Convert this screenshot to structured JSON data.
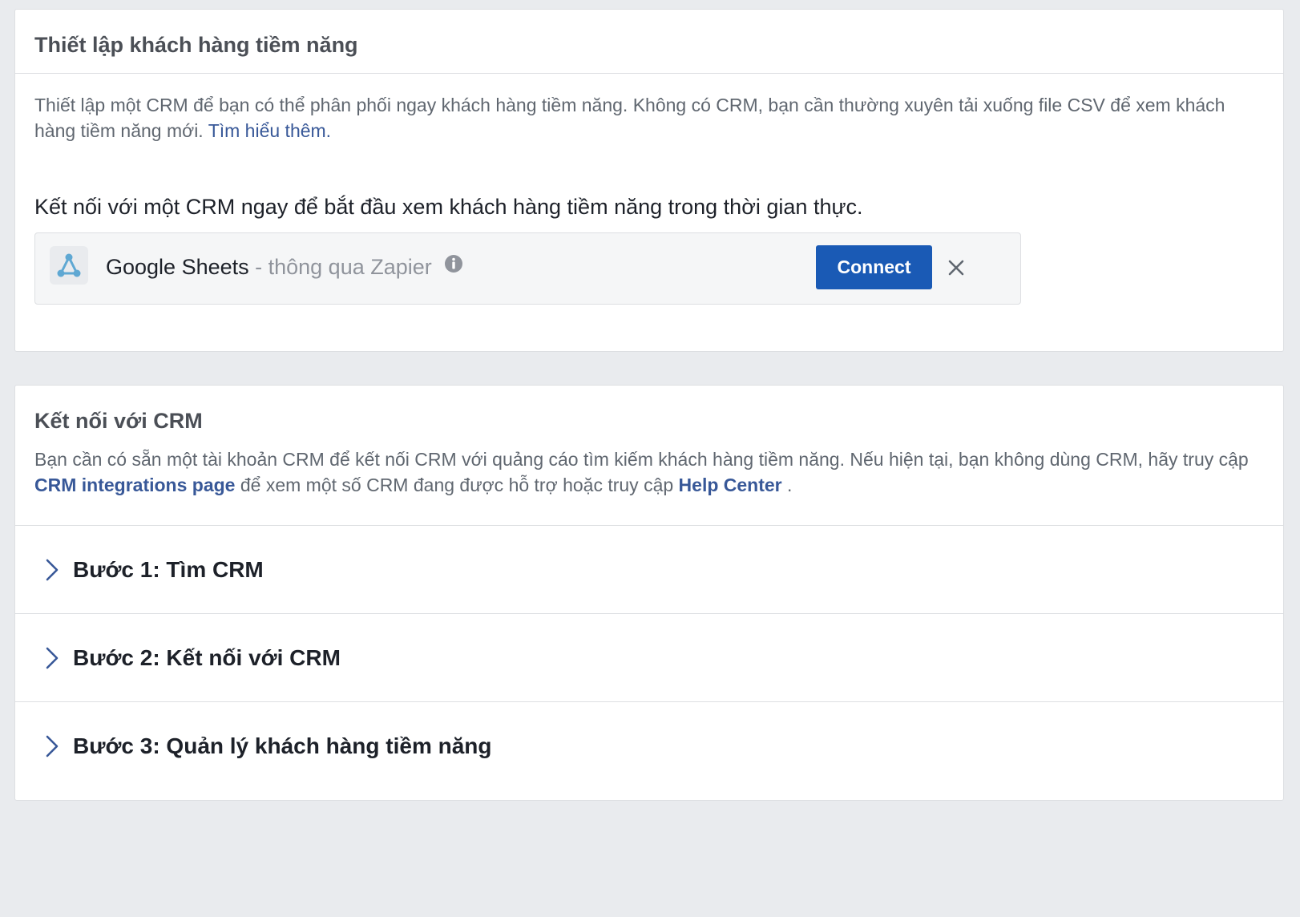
{
  "setup_card": {
    "title": "Thiết lập khách hàng tiềm năng",
    "description": "Thiết lập một CRM để bạn có thể phân phối ngay khách hàng tiềm năng. Không có CRM, bạn cần thường xuyên tải xuống file CSV để xem khách hàng tiềm năng mới.",
    "learn_more_link": "Tìm hiểu thêm.",
    "subheading": "Kết nối với một CRM ngay để bắt đầu xem khách hàng tiềm năng trong thời gian thực.",
    "crm": {
      "name": "Google Sheets",
      "via": " - thông qua Zapier",
      "logo_icon": "zapier-network-icon",
      "connect_label": "Connect"
    }
  },
  "connect_card": {
    "title": "Kết nối với CRM",
    "description_part1": "Bạn cần có sẵn một tài khoản CRM để kết nối CRM với quảng cáo tìm kiếm khách hàng tiềm năng. Nếu hiện tại, bạn không dùng CRM, hãy truy cập ",
    "integrations_link": "CRM integrations page",
    "description_part2": " để xem một số CRM đang được hỗ trợ hoặc truy cập ",
    "help_center_link": "Help Center",
    "description_part3": " .",
    "steps": [
      {
        "label": "Bước 1: Tìm CRM"
      },
      {
        "label": "Bước 2: Kết nối với CRM"
      },
      {
        "label": "Bước 3: Quản lý khách hàng tiềm năng"
      }
    ]
  },
  "colors": {
    "background": "#e9ebee",
    "link": "#385898",
    "button": "#1a5ab5",
    "logo_accent": "#5fa8d3"
  }
}
